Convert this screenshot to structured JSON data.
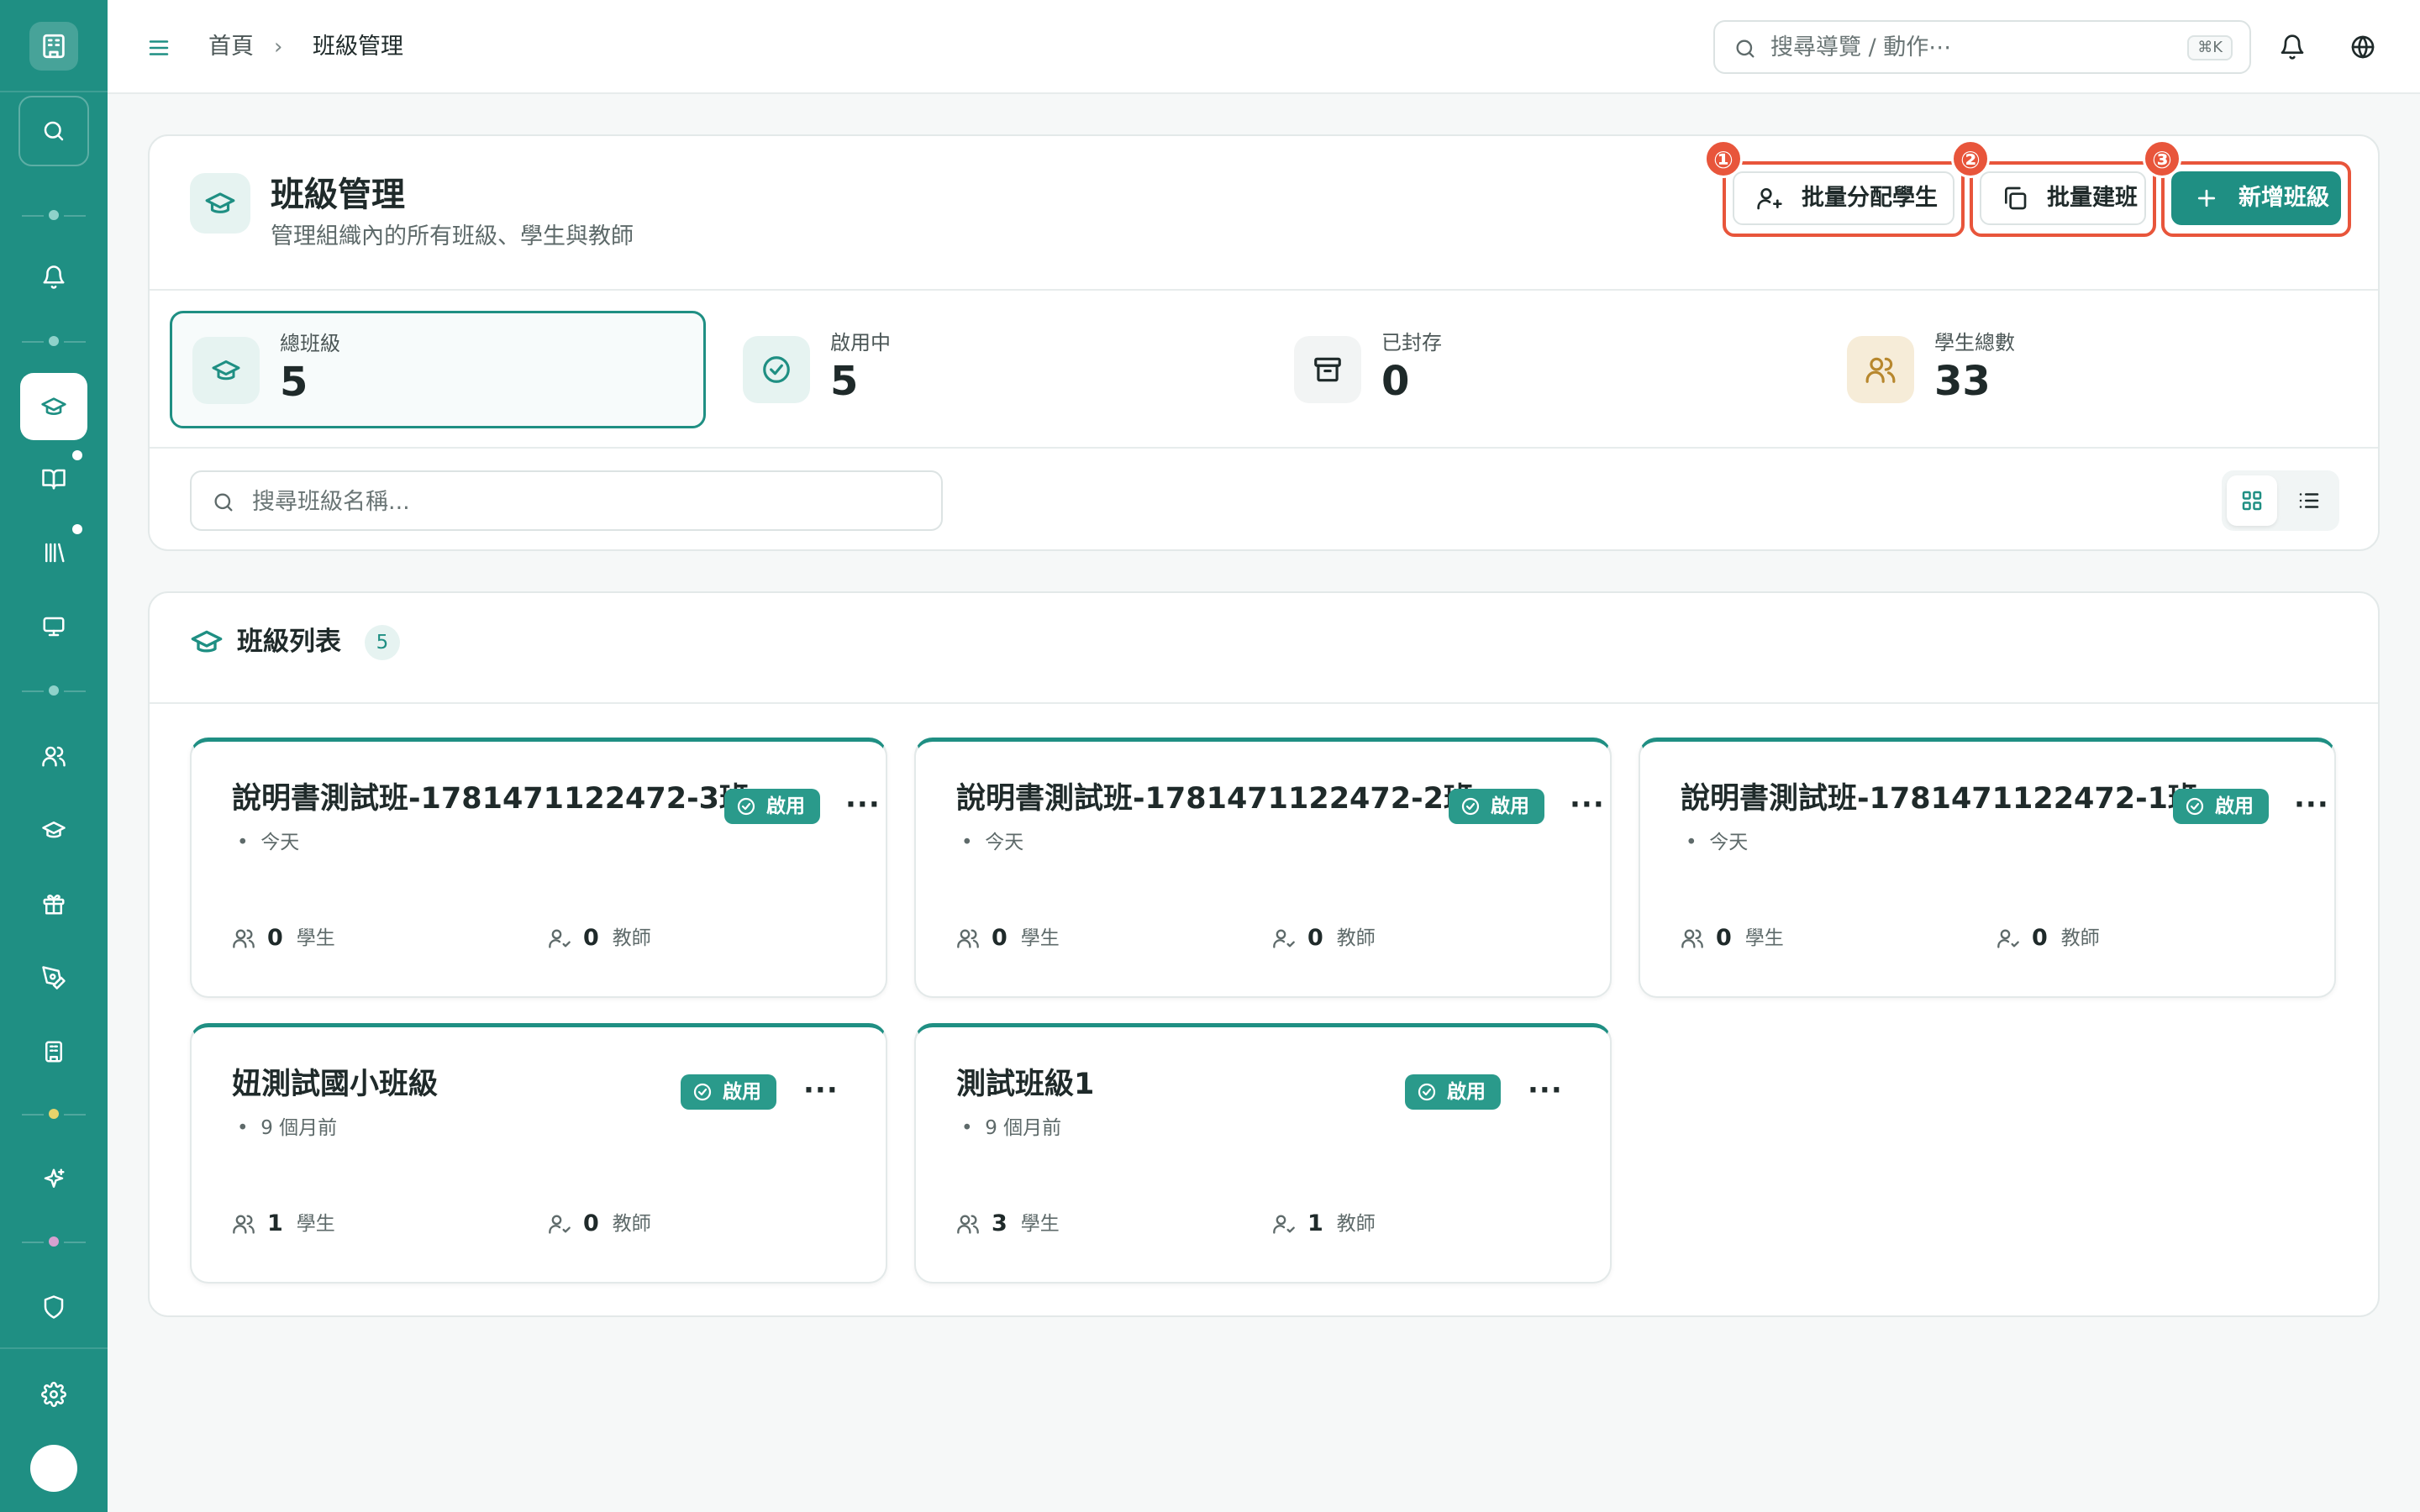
{
  "topbar": {
    "breadcrumb_home": "首頁",
    "breadcrumb_sep": "›",
    "breadcrumb_current": "班級管理",
    "search_placeholder": "搜尋導覽 / 動作⋯",
    "search_shortcut": "⌘K"
  },
  "header": {
    "title": "班級管理",
    "subtitle": "管理組織內的所有班級、學生與教師",
    "actions": {
      "assign_label": "批量分配學生",
      "bulk_create_label": "批量建班",
      "add_label": "新增班級"
    },
    "markers": [
      "①",
      "②",
      "③"
    ]
  },
  "stats": [
    {
      "label": "總班級",
      "value": "5"
    },
    {
      "label": "啟用中",
      "value": "5"
    },
    {
      "label": "已封存",
      "value": "0"
    },
    {
      "label": "學生總數",
      "value": "33"
    }
  ],
  "filter": {
    "search_placeholder": "搜尋班級名稱..."
  },
  "list": {
    "title": "班級列表",
    "count": "5",
    "students_label": "學生",
    "teachers_label": "教師",
    "status_label": "啟用",
    "more_label": "···",
    "bullet": "•",
    "classes": [
      {
        "name": "說明書測試班-1781471122472-3班",
        "time": "今天",
        "students": "0",
        "teachers": "0"
      },
      {
        "name": "說明書測試班-1781471122472-2班",
        "time": "今天",
        "students": "0",
        "teachers": "0"
      },
      {
        "name": "說明書測試班-1781471122472-1班",
        "time": "今天",
        "students": "0",
        "teachers": "0"
      },
      {
        "name": "妞測試國小班級",
        "time": "9 個月前",
        "students": "1",
        "teachers": "0"
      },
      {
        "name": "測試班級1",
        "time": "9 個月前",
        "students": "3",
        "teachers": "1"
      }
    ]
  },
  "colors": {
    "brand": "#1f8f83",
    "highlight": "#e8553b",
    "badge": "#2a9a8b"
  }
}
